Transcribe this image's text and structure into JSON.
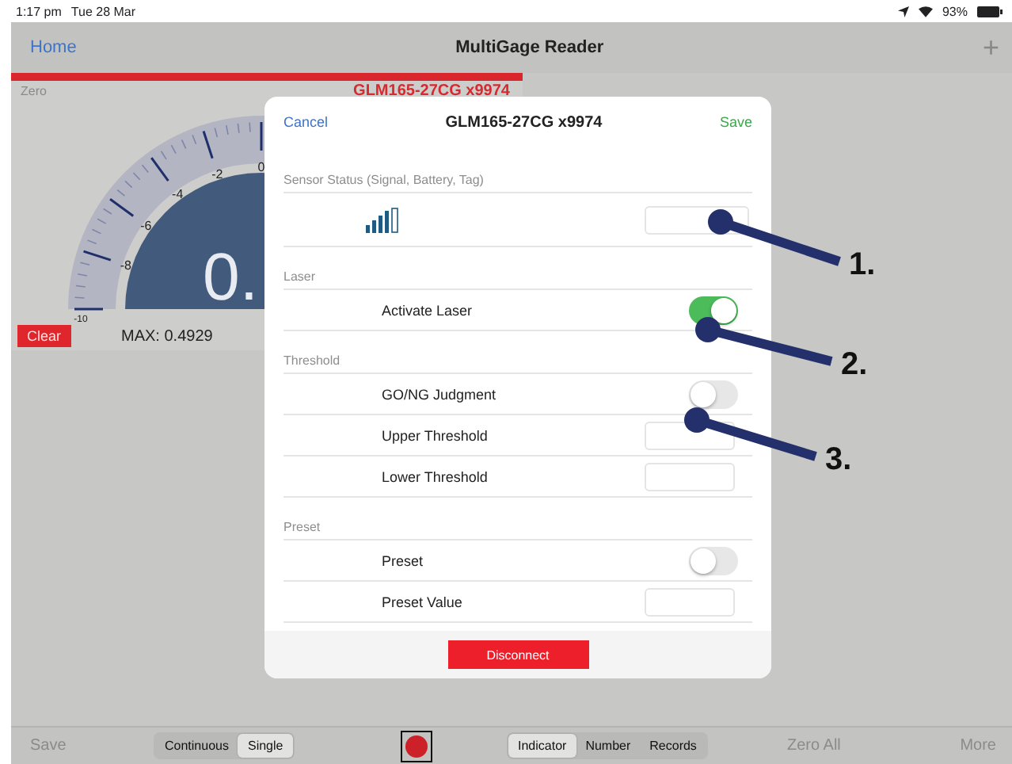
{
  "status_bar": {
    "time": "1:17 pm",
    "date": "Tue 28 Mar",
    "battery": "93%"
  },
  "nav": {
    "back": "Home",
    "title": "MultiGage Reader",
    "add": "+"
  },
  "gauge": {
    "zero": "Zero",
    "device": "GLM165-27CG x9974",
    "ticks": [
      "0",
      "-2",
      "-4",
      "-6",
      "-8",
      "-10"
    ],
    "reading": "0.",
    "clear": "Clear",
    "max": "MAX: 0.4929"
  },
  "modal": {
    "cancel": "Cancel",
    "title": "GLM165-27CG x9974",
    "save": "Save",
    "sections": [
      {
        "header": "Sensor Status (Signal, Battery, Tag)",
        "rows": [
          {
            "kind": "status"
          }
        ]
      },
      {
        "header": "Laser",
        "rows": [
          {
            "kind": "toggle",
            "label": "Activate Laser",
            "on": true
          }
        ]
      },
      {
        "header": "Threshold",
        "rows": [
          {
            "kind": "toggle",
            "label": "GO/NG Judgment",
            "on": false
          },
          {
            "kind": "field",
            "label": "Upper Threshold"
          },
          {
            "kind": "field",
            "label": "Lower Threshold"
          }
        ]
      },
      {
        "header": "Preset",
        "rows": [
          {
            "kind": "toggle",
            "label": "Preset",
            "on": false
          },
          {
            "kind": "field",
            "label": "Preset Value"
          }
        ]
      }
    ],
    "disconnect": "Disconnect"
  },
  "toolbar": {
    "save": "Save",
    "modes": [
      {
        "label": "Continuous",
        "selected": false
      },
      {
        "label": "Single",
        "selected": true
      }
    ],
    "views": [
      {
        "label": "Indicator",
        "selected": true
      },
      {
        "label": "Number",
        "selected": false
      },
      {
        "label": "Records",
        "selected": false
      }
    ],
    "zero_all": "Zero All",
    "more": "More"
  },
  "annotations": [
    "1.",
    "2.",
    "3."
  ]
}
